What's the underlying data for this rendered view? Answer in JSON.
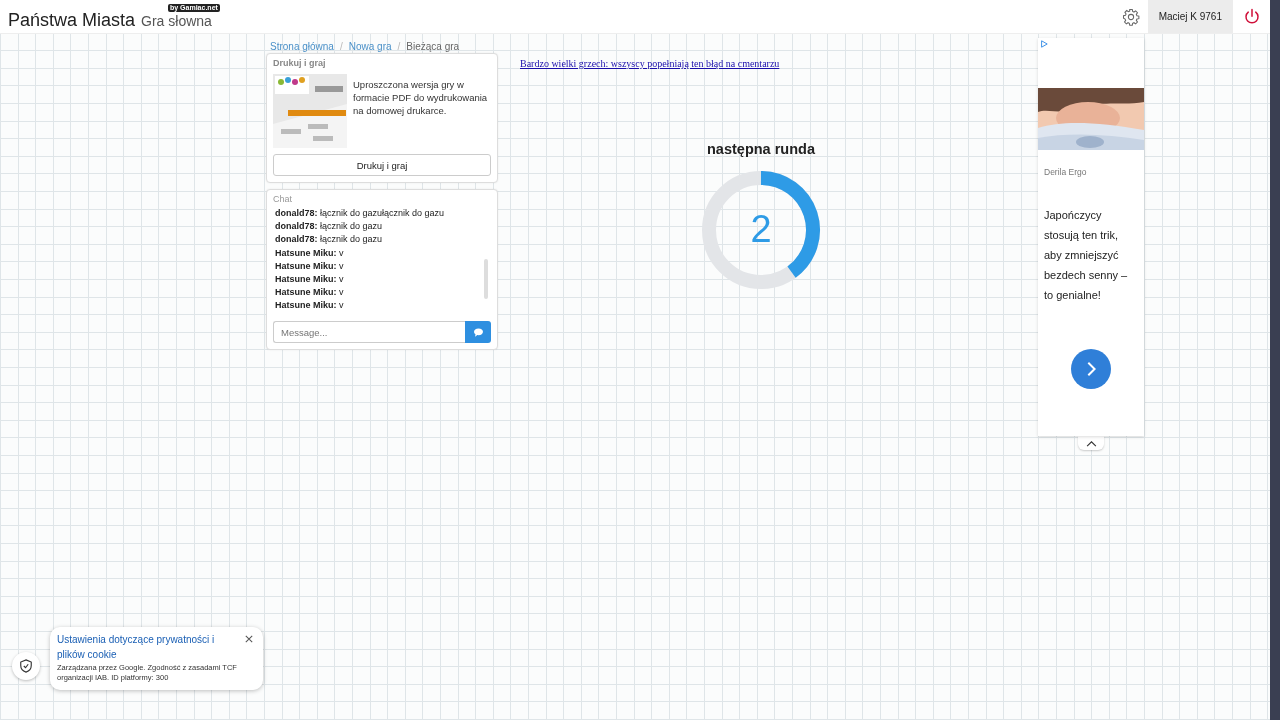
{
  "header": {
    "title": "Państwa Miasta",
    "subtitle": "Gra słowna",
    "badge": "by Gamiac.net",
    "user": "Maciej K 9761"
  },
  "breadcrumb": {
    "separator": "/",
    "items": [
      {
        "label": "Strona główna",
        "kind": "link"
      },
      {
        "label": "Nowa gra",
        "kind": "link"
      },
      {
        "label": "Bieżąca gra",
        "kind": "current"
      }
    ]
  },
  "print_card": {
    "title": "Drukuj i graj",
    "description": "Uproszczona wersja gry w formacie PDF do wydrukowania na domowej drukarce.",
    "button": "Drukuj i graj"
  },
  "chat": {
    "title": "Chat",
    "messages": [
      {
        "author": "donald78:",
        "text": "łącznik do gazułącznik do gazu"
      },
      {
        "author": "donald78:",
        "text": "łącznik do gazu"
      },
      {
        "author": "donald78:",
        "text": "łącznik do gazu"
      },
      {
        "author": "Hatsune Miku:",
        "text": "v"
      },
      {
        "author": "Hatsune Miku:",
        "text": "v"
      },
      {
        "author": "Hatsune Miku:",
        "text": "v"
      },
      {
        "author": "Hatsune Miku:",
        "text": "v"
      },
      {
        "author": "Hatsune Miku:",
        "text": "v"
      }
    ],
    "placeholder": "Message..."
  },
  "ad_link": "Bardzo wielki grzech: wszyscy popełniają ten błąd na cmentarzu",
  "countdown": {
    "title": "następna runda",
    "number": "2"
  },
  "ad": {
    "advertiser": "Derila Ergo",
    "text": "Japończycy stosują ten trik, aby zmniejszyć bezdech senny – to genialne!"
  },
  "cookie": {
    "title": "Ustawienia dotyczące prywatności i plików cookie",
    "text": "Zarządzana przez Google. Zgodność z zasadami TCF organizacji IAB. ID platformy: 300"
  }
}
